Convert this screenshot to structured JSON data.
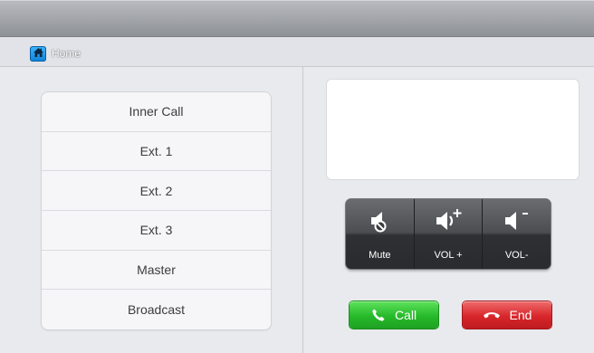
{
  "header": {
    "home_label": "Home"
  },
  "menu": {
    "items": [
      {
        "label": "Inner Call"
      },
      {
        "label": "Ext. 1"
      },
      {
        "label": "Ext. 2"
      },
      {
        "label": "Ext. 3"
      },
      {
        "label": "Master"
      },
      {
        "label": "Broadcast"
      }
    ]
  },
  "volume": {
    "mute_label": "Mute",
    "vol_up_label": "VOL +",
    "vol_down_label": "VOL-"
  },
  "actions": {
    "call_label": "Call",
    "end_label": "End"
  },
  "colors": {
    "accent_home": "#1a9bef",
    "call_green": "#26b92a",
    "end_red": "#d8262b"
  },
  "icons": {
    "home": "home-icon",
    "mute": "mute-icon",
    "vol_up": "volume-up-icon",
    "vol_down": "volume-down-icon",
    "call": "phone-icon",
    "end": "hang-up-icon"
  }
}
